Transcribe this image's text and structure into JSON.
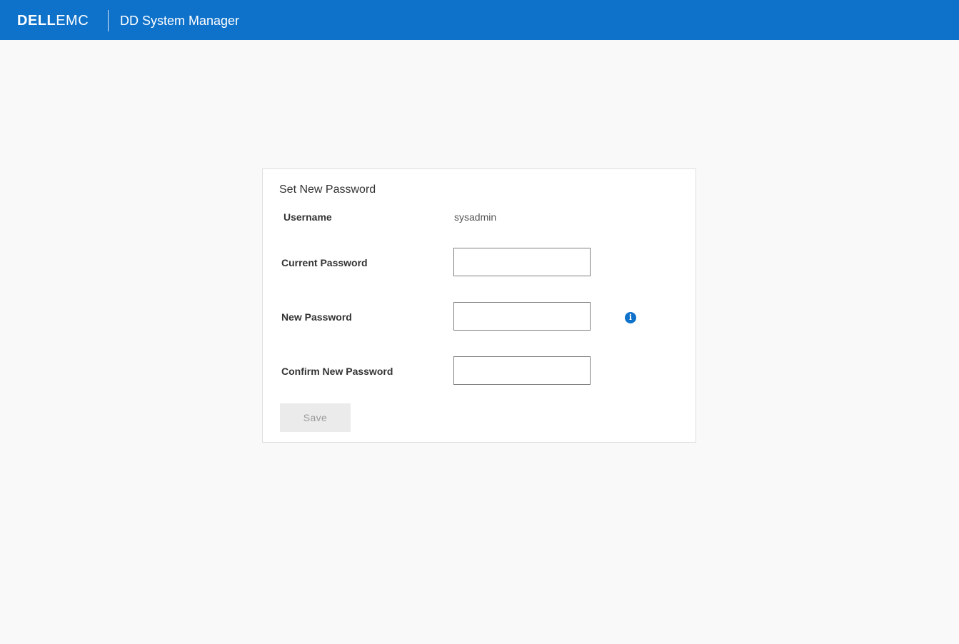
{
  "header": {
    "brand_dell": "DELL",
    "brand_emc": "EMC",
    "app_title": "DD System Manager"
  },
  "form": {
    "title": "Set New Password",
    "username_label": "Username",
    "username_value": "sysadmin",
    "current_password_label": "Current Password",
    "current_password_value": "",
    "new_password_label": "New Password",
    "new_password_value": "",
    "confirm_password_label": "Confirm New Password",
    "confirm_password_value": "",
    "info_icon": "i",
    "save_label": "Save"
  },
  "colors": {
    "header_bg": "#0f72ca",
    "page_bg": "#f9f9f9",
    "button_disabled_bg": "#ebebeb",
    "info_icon": "#0f72ca"
  }
}
